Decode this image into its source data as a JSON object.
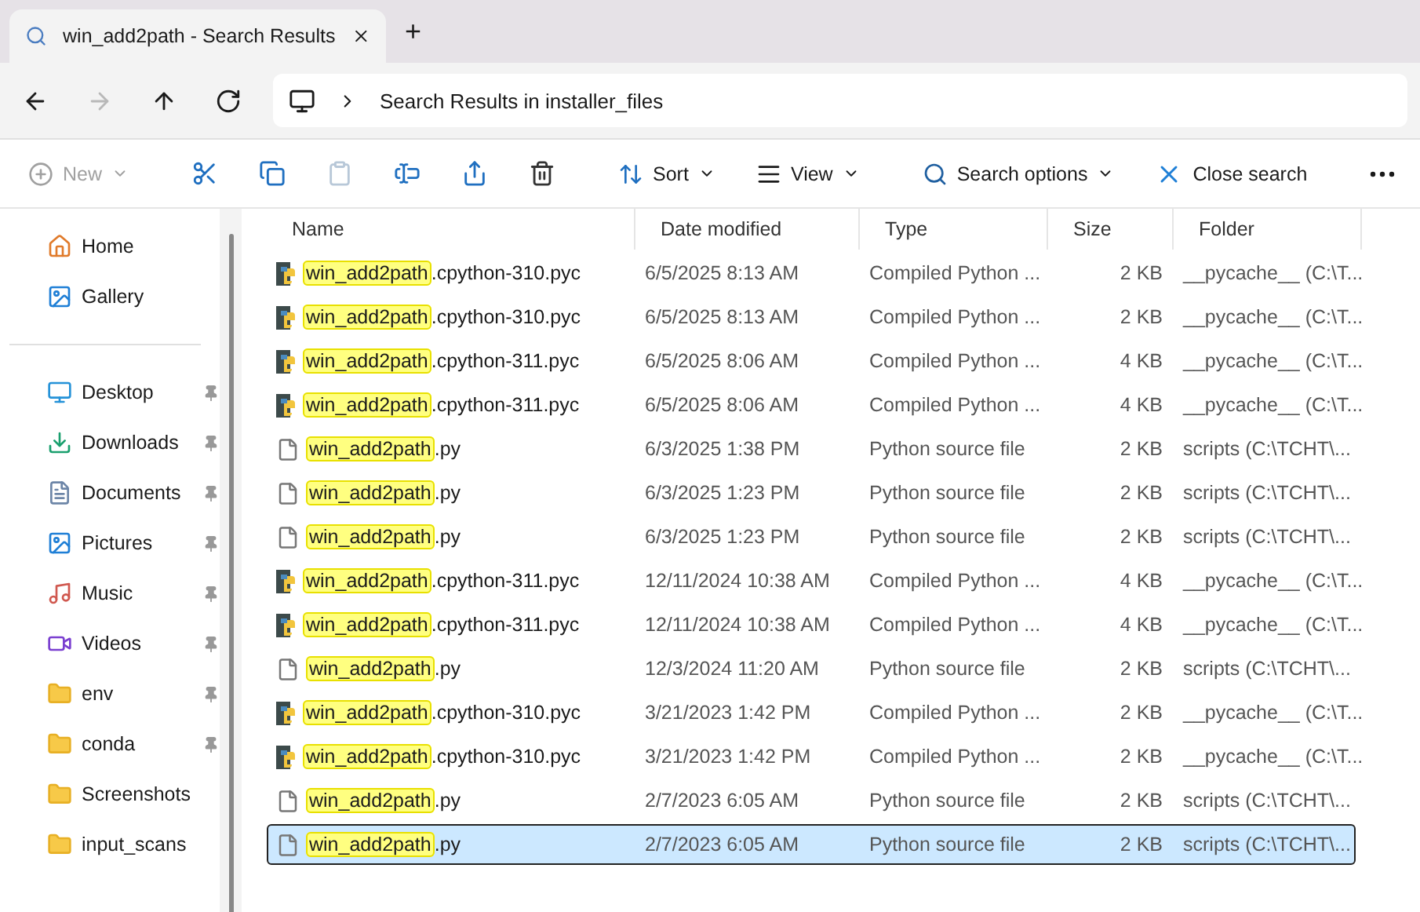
{
  "tab": {
    "title": "win_add2path - Search Results",
    "new_tab": "+"
  },
  "nav": {
    "buttons": [
      {
        "kind": "back",
        "disabled": false
      },
      {
        "kind": "forward",
        "disabled": true
      },
      {
        "kind": "up",
        "disabled": false
      },
      {
        "kind": "refresh",
        "disabled": false
      }
    ],
    "address": "Search Results in installer_files"
  },
  "toolbar": {
    "new": {
      "label": "New",
      "disabled": true
    },
    "icon_buttons": [
      {
        "kind": "cut",
        "disabled": false
      },
      {
        "kind": "copy",
        "disabled": false
      },
      {
        "kind": "paste",
        "disabled": true
      },
      {
        "kind": "rename",
        "disabled": false
      },
      {
        "kind": "share",
        "disabled": false
      },
      {
        "kind": "delete",
        "disabled": false
      }
    ],
    "sort": "Sort",
    "view": "View",
    "search_options": "Search options",
    "close_search": "Close search"
  },
  "sidebar": {
    "groups": [
      [
        {
          "label": "Home",
          "kind": "home",
          "pinned": false
        },
        {
          "label": "Gallery",
          "kind": "gallery",
          "pinned": false
        }
      ],
      [
        {
          "label": "Desktop",
          "kind": "desktop",
          "pinned": true
        },
        {
          "label": "Downloads",
          "kind": "downloads",
          "pinned": true
        },
        {
          "label": "Documents",
          "kind": "documents",
          "pinned": true
        },
        {
          "label": "Pictures",
          "kind": "pictures",
          "pinned": true
        },
        {
          "label": "Music",
          "kind": "music",
          "pinned": true
        },
        {
          "label": "Videos",
          "kind": "videos",
          "pinned": true
        },
        {
          "label": "env",
          "kind": "folder",
          "pinned": true
        },
        {
          "label": "conda",
          "kind": "folder",
          "pinned": true
        },
        {
          "label": "Screenshots",
          "kind": "folder",
          "pinned": false
        },
        {
          "label": "input_scans",
          "kind": "folder",
          "pinned": false
        }
      ]
    ]
  },
  "table": {
    "columns": [
      "Name",
      "Date modified",
      "Type",
      "Size",
      "Folder"
    ],
    "rows": [
      {
        "kind": "pyc",
        "match": "win_add2path",
        "rest": ".cpython-310.pyc",
        "date": "6/5/2025 8:13 AM",
        "type": "Compiled Python ...",
        "size": "2 KB",
        "folder": "__pycache__ (C:\\T...",
        "selected": false
      },
      {
        "kind": "pyc",
        "match": "win_add2path",
        "rest": ".cpython-310.pyc",
        "date": "6/5/2025 8:13 AM",
        "type": "Compiled Python ...",
        "size": "2 KB",
        "folder": "__pycache__ (C:\\T...",
        "selected": false
      },
      {
        "kind": "pyc",
        "match": "win_add2path",
        "rest": ".cpython-311.pyc",
        "date": "6/5/2025 8:06 AM",
        "type": "Compiled Python ...",
        "size": "4 KB",
        "folder": "__pycache__ (C:\\T...",
        "selected": false
      },
      {
        "kind": "pyc",
        "match": "win_add2path",
        "rest": ".cpython-311.pyc",
        "date": "6/5/2025 8:06 AM",
        "type": "Compiled Python ...",
        "size": "4 KB",
        "folder": "__pycache__ (C:\\T...",
        "selected": false
      },
      {
        "kind": "py",
        "match": "win_add2path",
        "rest": ".py",
        "date": "6/3/2025 1:38 PM",
        "type": "Python source file",
        "size": "2 KB",
        "folder": "scripts (C:\\TCHT\\...",
        "selected": false
      },
      {
        "kind": "py",
        "match": "win_add2path",
        "rest": ".py",
        "date": "6/3/2025 1:23 PM",
        "type": "Python source file",
        "size": "2 KB",
        "folder": "scripts (C:\\TCHT\\...",
        "selected": false
      },
      {
        "kind": "py",
        "match": "win_add2path",
        "rest": ".py",
        "date": "6/3/2025 1:23 PM",
        "type": "Python source file",
        "size": "2 KB",
        "folder": "scripts (C:\\TCHT\\...",
        "selected": false
      },
      {
        "kind": "pyc",
        "match": "win_add2path",
        "rest": ".cpython-311.pyc",
        "date": "12/11/2024 10:38 AM",
        "type": "Compiled Python ...",
        "size": "4 KB",
        "folder": "__pycache__ (C:\\T...",
        "selected": false
      },
      {
        "kind": "pyc",
        "match": "win_add2path",
        "rest": ".cpython-311.pyc",
        "date": "12/11/2024 10:38 AM",
        "type": "Compiled Python ...",
        "size": "4 KB",
        "folder": "__pycache__ (C:\\T...",
        "selected": false
      },
      {
        "kind": "py",
        "match": "win_add2path",
        "rest": ".py",
        "date": "12/3/2024 11:20 AM",
        "type": "Python source file",
        "size": "2 KB",
        "folder": "scripts (C:\\TCHT\\...",
        "selected": false
      },
      {
        "kind": "pyc",
        "match": "win_add2path",
        "rest": ".cpython-310.pyc",
        "date": "3/21/2023 1:42 PM",
        "type": "Compiled Python ...",
        "size": "2 KB",
        "folder": "__pycache__ (C:\\T...",
        "selected": false
      },
      {
        "kind": "pyc",
        "match": "win_add2path",
        "rest": ".cpython-310.pyc",
        "date": "3/21/2023 1:42 PM",
        "type": "Compiled Python ...",
        "size": "2 KB",
        "folder": "__pycache__ (C:\\T...",
        "selected": false
      },
      {
        "kind": "py",
        "match": "win_add2path",
        "rest": ".py",
        "date": "2/7/2023 6:05 AM",
        "type": "Python source file",
        "size": "2 KB",
        "folder": "scripts (C:\\TCHT\\...",
        "selected": false
      },
      {
        "kind": "py",
        "match": "win_add2path",
        "rest": ".py",
        "date": "2/7/2023 6:05 AM",
        "type": "Python source file",
        "size": "2 KB",
        "folder": "scripts (C:\\TCHT\\...",
        "selected": true
      }
    ]
  }
}
